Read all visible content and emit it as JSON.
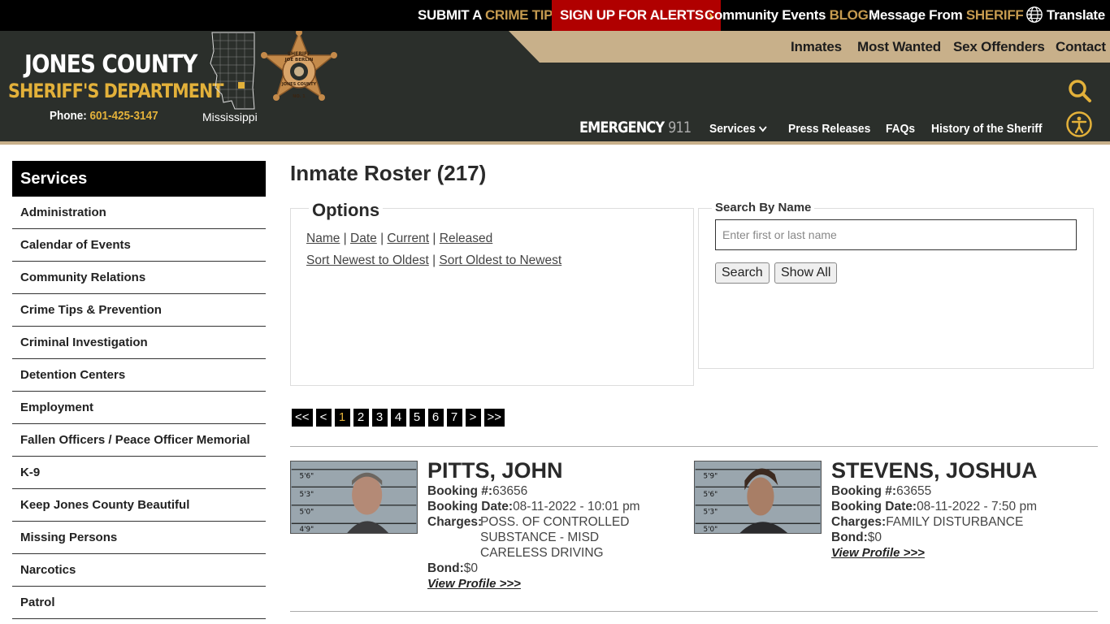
{
  "topbar": {
    "tip_a": "SUBMIT A",
    "tip_b": "CRIME TIP",
    "alerts": "SIGN UP FOR ALERTS",
    "events_a": "Community Events",
    "events_b": "BLOG",
    "msg_a": "Message From",
    "msg_b": "SHERIFF",
    "translate": "Translate",
    "chevron": "›"
  },
  "brand": {
    "line1": "JONES COUNTY",
    "line2": "SHERIFF'S DEPARTMENT",
    "phone_label": "Phone:",
    "phone": "601-425-3147",
    "state": "Mississippi",
    "badge_top": "SHERIFF",
    "badge_name": "JOE BERLIN",
    "badge_bottom": "JONES COUNTY",
    "badge_no": "NO. 1"
  },
  "nav_top": [
    "Inmates",
    "Most Wanted",
    "Sex Offenders",
    "Contact"
  ],
  "nav_main": {
    "emergency": "EMERGENCY",
    "emergency_num": "911",
    "services": "Services",
    "press": "Press Releases",
    "faqs": "FAQs",
    "history": "History of the Sheriff"
  },
  "sidebar": {
    "title": "Services",
    "items": [
      "Administration",
      "Calendar of Events",
      "Community Relations",
      "Crime Tips & Prevention",
      "Criminal Investigation",
      "Detention Centers",
      "Employment",
      "Fallen Officers / Peace Officer Memorial",
      "K-9",
      "Keep Jones County Beautiful",
      "Missing Persons",
      "Narcotics",
      "Patrol"
    ]
  },
  "main": {
    "title": "Inmate Roster (217)",
    "options": {
      "legend": "Options",
      "sort_name": "Name",
      "sort_date": "Date",
      "filter_current": "Current",
      "filter_released": "Released",
      "newest": "Sort Newest to Oldest",
      "oldest": "Sort Oldest to Newest",
      "sep": "|"
    },
    "search": {
      "legend": "Search By Name",
      "placeholder": "Enter first or last name",
      "button": "Search",
      "show_all": "Show All"
    },
    "pager": [
      "<<",
      "<",
      "1",
      "2",
      "3",
      "4",
      "5",
      "6",
      "7",
      ">",
      ">>"
    ],
    "pager_active": "1",
    "inmates": [
      {
        "name": "PITTS, JOHN",
        "booking_label": "Booking #:",
        "booking": "63656",
        "date_label": "Booking Date:",
        "date": "08-11-2022 - 10:01 pm",
        "charges_label": "Charges:",
        "charges": [
          "POSS. OF CONTROLLED",
          "SUBSTANCE - MISD",
          "CARELESS DRIVING"
        ],
        "bond_label": "Bond:",
        "bond": "$0",
        "link": "View Profile >>>",
        "marks": [
          "5'6\"",
          "5'3\"",
          "5'0\"",
          "4'9\""
        ]
      },
      {
        "name": "STEVENS, JOSHUA",
        "booking_label": "Booking #:",
        "booking": "63655",
        "date_label": "Booking Date:",
        "date": "08-11-2022 - 7:50 pm",
        "charges_label": "Charges:",
        "charges": [
          "FAMILY DISTURBANCE"
        ],
        "bond_label": "Bond:",
        "bond": "$0",
        "link": "View Profile >>>",
        "marks": [
          "5'9\"",
          "5'6\"",
          "5'3\"",
          "5'0\""
        ]
      }
    ]
  }
}
